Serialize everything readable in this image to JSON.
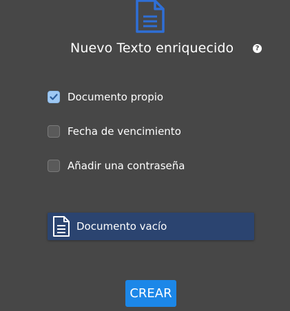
{
  "dialog": {
    "title": "Nuevo Texto enriquecido",
    "help_icon": "question-circle-icon",
    "header_icon": "document-icon"
  },
  "options": [
    {
      "label": "Documento propio",
      "checked": true
    },
    {
      "label": "Fecha de vencimiento",
      "checked": false
    },
    {
      "label": "Añadir una contraseña",
      "checked": false
    }
  ],
  "template": {
    "label": "Documento vacío",
    "icon": "document-icon",
    "selected": true
  },
  "actions": {
    "create_label": "CREAR"
  },
  "colors": {
    "background": "#474747",
    "accent": "#1c87e8",
    "selected_card": "#2b4470",
    "checkbox_checked": "#9ec8f3",
    "header_icon": "#2f6fd6"
  }
}
